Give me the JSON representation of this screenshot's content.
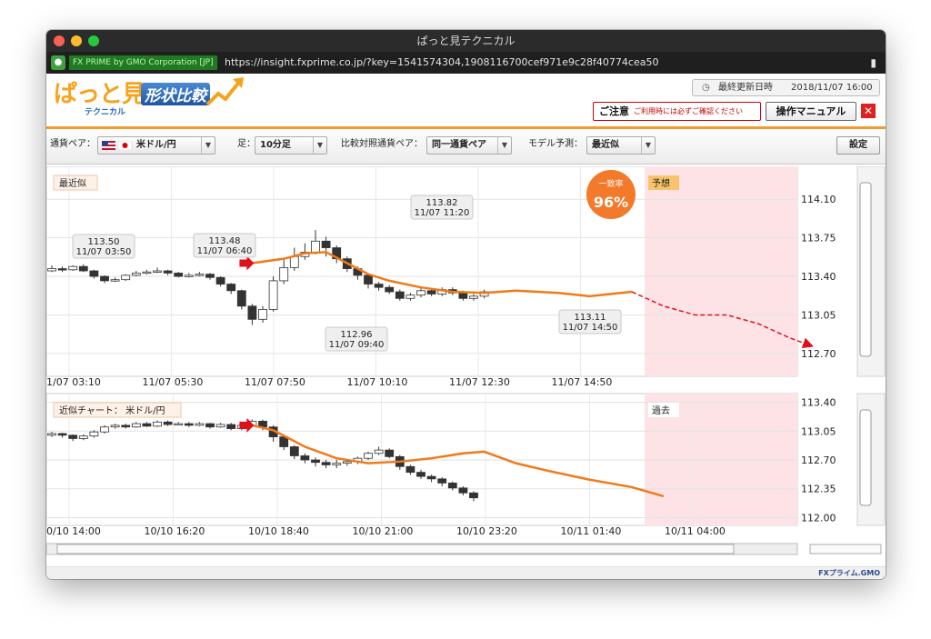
{
  "window": {
    "title": "ぱっと見テクニカル"
  },
  "browser": {
    "cert_label": "FX PRIME by GMO Corporation [JP]",
    "url": "https://insight.fxprime.co.jp/?key=1541574304,1908116700cef971e9c28f40774cea50"
  },
  "header": {
    "logo_main": "ぱっと見",
    "logo_sub": "テクニカル",
    "logo_shape": "形状比較",
    "last_updated_label": "最終更新日時",
    "last_updated_value": "2018/11/07 16:00",
    "caution_title": "ご注意",
    "caution_text": "ご利用時には必ずご確認ください",
    "manual_button": "操作マニュアル"
  },
  "toolbar": {
    "pair_label": "通貨ペア：",
    "pair_value": "米ドル/円",
    "bar_label": "足：",
    "bar_value": "10分足",
    "compare_label": "比較対照通貨ペア：",
    "compare_value": "同一通貨ペア",
    "model_label": "モデル予測：",
    "model_value": "最近似",
    "settings_button": "設定"
  },
  "colors": {
    "candle_up": "#ffffff",
    "candle_down": "#333333",
    "fit_line": "#f07a1a",
    "forecast_line": "#e0101a",
    "forecast_bg": "#fde3e6",
    "accent": "#f39a2f"
  },
  "chart_data": [
    {
      "type": "line",
      "panel_label": "最近似",
      "match_rate_label": "一致率",
      "match_rate": "96%",
      "zone_label": "予想",
      "x_ticks": [
        "1/07 03:10",
        "11/07 05:30",
        "11/07 07:50",
        "11/07 10:10",
        "11/07 12:30",
        "11/07 14:50"
      ],
      "y_ticks": [
        "114.10",
        "113.75",
        "113.40",
        "113.05",
        "112.70"
      ],
      "ylim": [
        112.6,
        114.3
      ],
      "annotations": [
        {
          "value": "113.50",
          "time": "11/07 03:50"
        },
        {
          "value": "113.48",
          "time": "11/07 06:40"
        },
        {
          "value": "113.82",
          "time": "11/07 11:20"
        },
        {
          "value": "112.96",
          "time": "11/07 09:40"
        },
        {
          "value": "113.11",
          "time": "11/07 14:50"
        }
      ],
      "candles": [
        [
          113.45,
          113.47,
          113.5,
          113.44
        ],
        [
          113.47,
          113.46,
          113.49,
          113.44
        ],
        [
          113.46,
          113.49,
          113.5,
          113.45
        ],
        [
          113.49,
          113.45,
          113.51,
          113.44
        ],
        [
          113.45,
          113.4,
          113.46,
          113.38
        ],
        [
          113.4,
          113.36,
          113.41,
          113.34
        ],
        [
          113.36,
          113.37,
          113.39,
          113.35
        ],
        [
          113.37,
          113.41,
          113.42,
          113.36
        ],
        [
          113.41,
          113.43,
          113.45,
          113.4
        ],
        [
          113.43,
          113.44,
          113.46,
          113.42
        ],
        [
          113.44,
          113.45,
          113.48,
          113.43
        ],
        [
          113.45,
          113.43,
          113.46,
          113.41
        ],
        [
          113.43,
          113.4,
          113.44,
          113.39
        ],
        [
          113.4,
          113.41,
          113.43,
          113.39
        ],
        [
          113.41,
          113.42,
          113.44,
          113.4
        ],
        [
          113.42,
          113.39,
          113.43,
          113.37
        ],
        [
          113.39,
          113.33,
          113.4,
          113.31
        ],
        [
          113.33,
          113.27,
          113.34,
          113.24
        ],
        [
          113.27,
          113.13,
          113.28,
          113.1
        ],
        [
          113.13,
          113.01,
          113.15,
          112.96
        ],
        [
          113.01,
          113.1,
          113.13,
          112.98
        ],
        [
          113.1,
          113.36,
          113.4,
          113.08
        ],
        [
          113.36,
          113.48,
          113.55,
          113.33
        ],
        [
          113.48,
          113.58,
          113.66,
          113.45
        ],
        [
          113.58,
          113.62,
          113.7,
          113.55
        ],
        [
          113.62,
          113.72,
          113.82,
          113.6
        ],
        [
          113.72,
          113.66,
          113.76,
          113.58
        ],
        [
          113.66,
          113.56,
          113.68,
          113.52
        ],
        [
          113.56,
          113.47,
          113.58,
          113.44
        ],
        [
          113.47,
          113.41,
          113.49,
          113.37
        ],
        [
          113.41,
          113.33,
          113.43,
          113.29
        ],
        [
          113.33,
          113.3,
          113.35,
          113.27
        ],
        [
          113.3,
          113.26,
          113.32,
          113.24
        ],
        [
          113.26,
          113.2,
          113.28,
          113.18
        ],
        [
          113.2,
          113.23,
          113.25,
          113.18
        ],
        [
          113.23,
          113.27,
          113.29,
          113.21
        ],
        [
          113.27,
          113.24,
          113.29,
          113.22
        ],
        [
          113.24,
          113.28,
          113.3,
          113.22
        ],
        [
          113.28,
          113.25,
          113.3,
          113.23
        ],
        [
          113.25,
          113.2,
          113.27,
          113.18
        ],
        [
          113.2,
          113.22,
          113.24,
          113.18
        ],
        [
          113.22,
          113.26,
          113.28,
          113.2
        ]
      ],
      "fit": [
        [
          19,
          113.52
        ],
        [
          22,
          113.56
        ],
        [
          24,
          113.61
        ],
        [
          26,
          113.62
        ],
        [
          28,
          113.52
        ],
        [
          30,
          113.42
        ],
        [
          32,
          113.36
        ],
        [
          35,
          113.3
        ],
        [
          38,
          113.26
        ],
        [
          41,
          113.25
        ],
        [
          44,
          113.27
        ],
        [
          48,
          113.25
        ],
        [
          51,
          113.22
        ],
        [
          55,
          113.26
        ]
      ],
      "forecast": [
        [
          55,
          113.26
        ],
        [
          58,
          113.13
        ],
        [
          61,
          113.05
        ],
        [
          64,
          113.05
        ],
        [
          67,
          112.97
        ],
        [
          70,
          112.84
        ],
        [
          72,
          112.77
        ]
      ]
    },
    {
      "type": "line",
      "panel_label": "近似チャート： 米ドル/円",
      "zone_label": "過去",
      "x_ticks": [
        "0/10 14:00",
        "10/10 16:20",
        "10/10 18:40",
        "10/10 21:00",
        "10/10 23:20",
        "10/11 01:40",
        "10/11 04:00"
      ],
      "y_ticks": [
        "113.40",
        "113.05",
        "112.70",
        "112.35",
        "112.00"
      ],
      "ylim": [
        111.95,
        113.45
      ],
      "candles": [
        [
          113.0,
          113.02,
          113.04,
          112.98
        ],
        [
          113.02,
          113.0,
          113.03,
          112.97
        ],
        [
          113.0,
          112.96,
          113.01,
          112.93
        ],
        [
          112.96,
          112.99,
          113.01,
          112.94
        ],
        [
          112.99,
          113.04,
          113.06,
          112.97
        ],
        [
          113.04,
          113.1,
          113.12,
          113.02
        ],
        [
          113.1,
          113.12,
          113.14,
          113.08
        ],
        [
          113.12,
          113.1,
          113.14,
          113.08
        ],
        [
          113.1,
          113.14,
          113.16,
          113.09
        ],
        [
          113.14,
          113.11,
          113.16,
          113.1
        ],
        [
          113.11,
          113.16,
          113.18,
          113.1
        ],
        [
          113.16,
          113.13,
          113.18,
          113.11
        ],
        [
          113.13,
          113.14,
          113.16,
          113.12
        ],
        [
          113.14,
          113.12,
          113.16,
          113.1
        ],
        [
          113.12,
          113.14,
          113.16,
          113.11
        ],
        [
          113.14,
          113.1,
          113.15,
          113.08
        ],
        [
          113.1,
          113.13,
          113.15,
          113.09
        ],
        [
          113.13,
          113.08,
          113.15,
          113.06
        ],
        [
          113.08,
          113.12,
          113.14,
          113.06
        ],
        [
          113.12,
          113.17,
          113.19,
          113.11
        ],
        [
          113.17,
          113.1,
          113.19,
          113.06
        ],
        [
          113.1,
          112.98,
          113.12,
          112.92
        ],
        [
          112.98,
          112.86,
          113.0,
          112.82
        ],
        [
          112.86,
          112.75,
          112.88,
          112.71
        ],
        [
          112.75,
          112.7,
          112.78,
          112.66
        ],
        [
          112.7,
          112.67,
          112.73,
          112.62
        ],
        [
          112.67,
          112.64,
          112.7,
          112.6
        ],
        [
          112.64,
          112.66,
          112.7,
          112.6
        ],
        [
          112.66,
          112.68,
          112.71,
          112.63
        ],
        [
          112.68,
          112.72,
          112.74,
          112.65
        ],
        [
          112.72,
          112.78,
          112.8,
          112.7
        ],
        [
          112.78,
          112.82,
          112.86,
          112.76
        ],
        [
          112.82,
          112.74,
          112.84,
          112.72
        ],
        [
          112.74,
          112.62,
          112.76,
          112.58
        ],
        [
          112.62,
          112.55,
          112.64,
          112.52
        ],
        [
          112.55,
          112.5,
          112.58,
          112.47
        ],
        [
          112.5,
          112.47,
          112.52,
          112.43
        ],
        [
          112.47,
          112.42,
          112.49,
          112.38
        ],
        [
          112.42,
          112.36,
          112.44,
          112.33
        ],
        [
          112.36,
          112.3,
          112.38,
          112.27
        ],
        [
          112.3,
          112.24,
          112.32,
          112.2
        ]
      ],
      "fit": [
        [
          19,
          113.12
        ],
        [
          21,
          113.06
        ],
        [
          24,
          112.86
        ],
        [
          27,
          112.72
        ],
        [
          30,
          112.66
        ],
        [
          33,
          112.68
        ],
        [
          36,
          112.72
        ],
        [
          39,
          112.78
        ],
        [
          41,
          112.8
        ],
        [
          44,
          112.66
        ],
        [
          47,
          112.57
        ],
        [
          51,
          112.46
        ],
        [
          55,
          112.37
        ],
        [
          58,
          112.26
        ]
      ]
    }
  ]
}
